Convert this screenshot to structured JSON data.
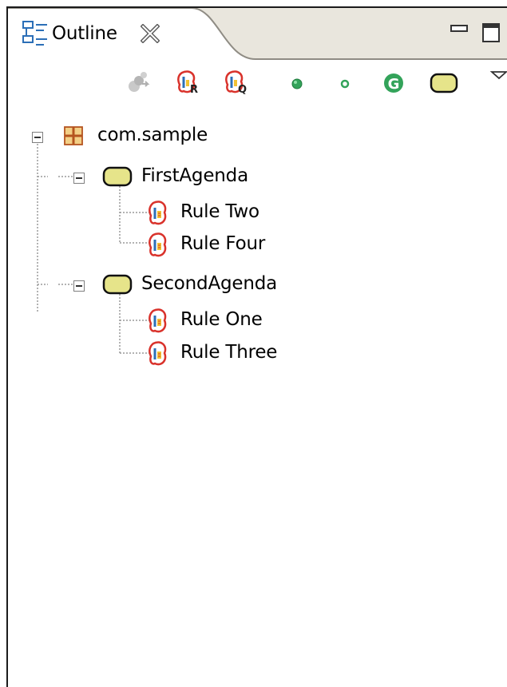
{
  "view": {
    "title": "Outline",
    "close_icon": "close-x-icon",
    "minimize_icon": "minimize-icon",
    "maximize_icon": "maximize-icon"
  },
  "toolbar": {
    "buttons": [
      {
        "icon": "filter-icon",
        "enabled": false
      },
      {
        "icon": "rule-r-icon"
      },
      {
        "icon": "rule-q-icon"
      },
      {
        "icon": "green-dot-icon"
      },
      {
        "icon": "small-green-dot-icon"
      },
      {
        "icon": "green-g-icon"
      },
      {
        "icon": "agenda-icon"
      },
      {
        "icon": "view-menu-icon"
      }
    ]
  },
  "tree": {
    "package": {
      "label": "com.sample",
      "icon": "package-icon",
      "expanded": true,
      "agendas": [
        {
          "label": "FirstAgenda",
          "icon": "agenda-icon",
          "expanded": true,
          "rules": [
            {
              "label": "Rule Two",
              "icon": "rule-icon"
            },
            {
              "label": "Rule Four",
              "icon": "rule-icon"
            }
          ]
        },
        {
          "label": "SecondAgenda",
          "icon": "agenda-icon",
          "expanded": true,
          "rules": [
            {
              "label": "Rule One",
              "icon": "rule-icon"
            },
            {
              "label": "Rule Three",
              "icon": "rule-icon"
            }
          ]
        }
      ]
    }
  },
  "colors": {
    "tab_bar": "#e9e6dd",
    "agenda_fill": "#e6e48a",
    "rule_red": "#d9322b",
    "green": "#33a35a"
  }
}
